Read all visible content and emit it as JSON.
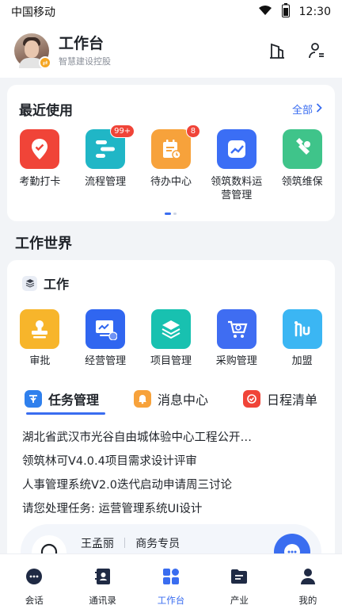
{
  "status_bar": {
    "carrier": "中国移动",
    "time": "12:30"
  },
  "header": {
    "title": "工作台",
    "subtitle": "智慧建设控股"
  },
  "recent": {
    "title": "最近使用",
    "more": "全部",
    "apps": [
      {
        "label": "考勤打卡",
        "icon": "location-check-icon",
        "color": "#f04438",
        "badge": ""
      },
      {
        "label": "流程管理",
        "icon": "flow-icon",
        "color": "#20b6c6",
        "badge": "99+"
      },
      {
        "label": "待办中心",
        "icon": "todo-calendar-icon",
        "color": "#f7a23b",
        "badge": "8"
      },
      {
        "label": "领筑数料运营管理",
        "icon": "chart-icon",
        "color": "#3b6ef5",
        "badge": ""
      },
      {
        "label": "领筑维保",
        "icon": "wrench-icon",
        "color": "#3fc48a",
        "badge": ""
      }
    ]
  },
  "section_title": "工作世界",
  "work": {
    "title": "工作",
    "apps": [
      {
        "label": "审批",
        "icon": "stamp-icon",
        "color": "#f7b52b"
      },
      {
        "label": "经营管理",
        "icon": "monitor-chart-icon",
        "color": "#3066f0"
      },
      {
        "label": "项目管理",
        "icon": "layers-icon",
        "color": "#18c1b0"
      },
      {
        "label": "采购管理",
        "icon": "cart-icon",
        "color": "#3f6df2"
      },
      {
        "label": "加盟",
        "icon": "join-icon",
        "color": "#3bb6f3"
      }
    ],
    "tabs": [
      {
        "label": "任务管理",
        "icon": "task-icon",
        "color": "#2f80ed"
      },
      {
        "label": "消息中心",
        "icon": "bell-icon",
        "color": "#f7a23b"
      },
      {
        "label": "日程清单",
        "icon": "schedule-check-icon",
        "color": "#f04438"
      }
    ],
    "tasks": [
      "湖北省武汉市光谷自由城体验中心工程公开…",
      "领筑林可V4.0.4项目需求设计评审",
      "人事管理系统V2.0迭代启动申请周三讨论",
      "请您处理任务: 运营管理系统UI设计"
    ],
    "contact": {
      "name": "王孟丽",
      "role": "商务专员"
    }
  },
  "tabbar": [
    {
      "label": "会话",
      "icon": "chat-icon"
    },
    {
      "label": "通讯录",
      "icon": "contacts-icon"
    },
    {
      "label": "工作台",
      "icon": "workbench-icon",
      "active": true
    },
    {
      "label": "产业",
      "icon": "folder-icon"
    },
    {
      "label": "我的",
      "icon": "user-icon"
    }
  ],
  "colors": {
    "accent": "#3a6df0",
    "badge": "#f04438",
    "background": "#f2f4f7"
  }
}
